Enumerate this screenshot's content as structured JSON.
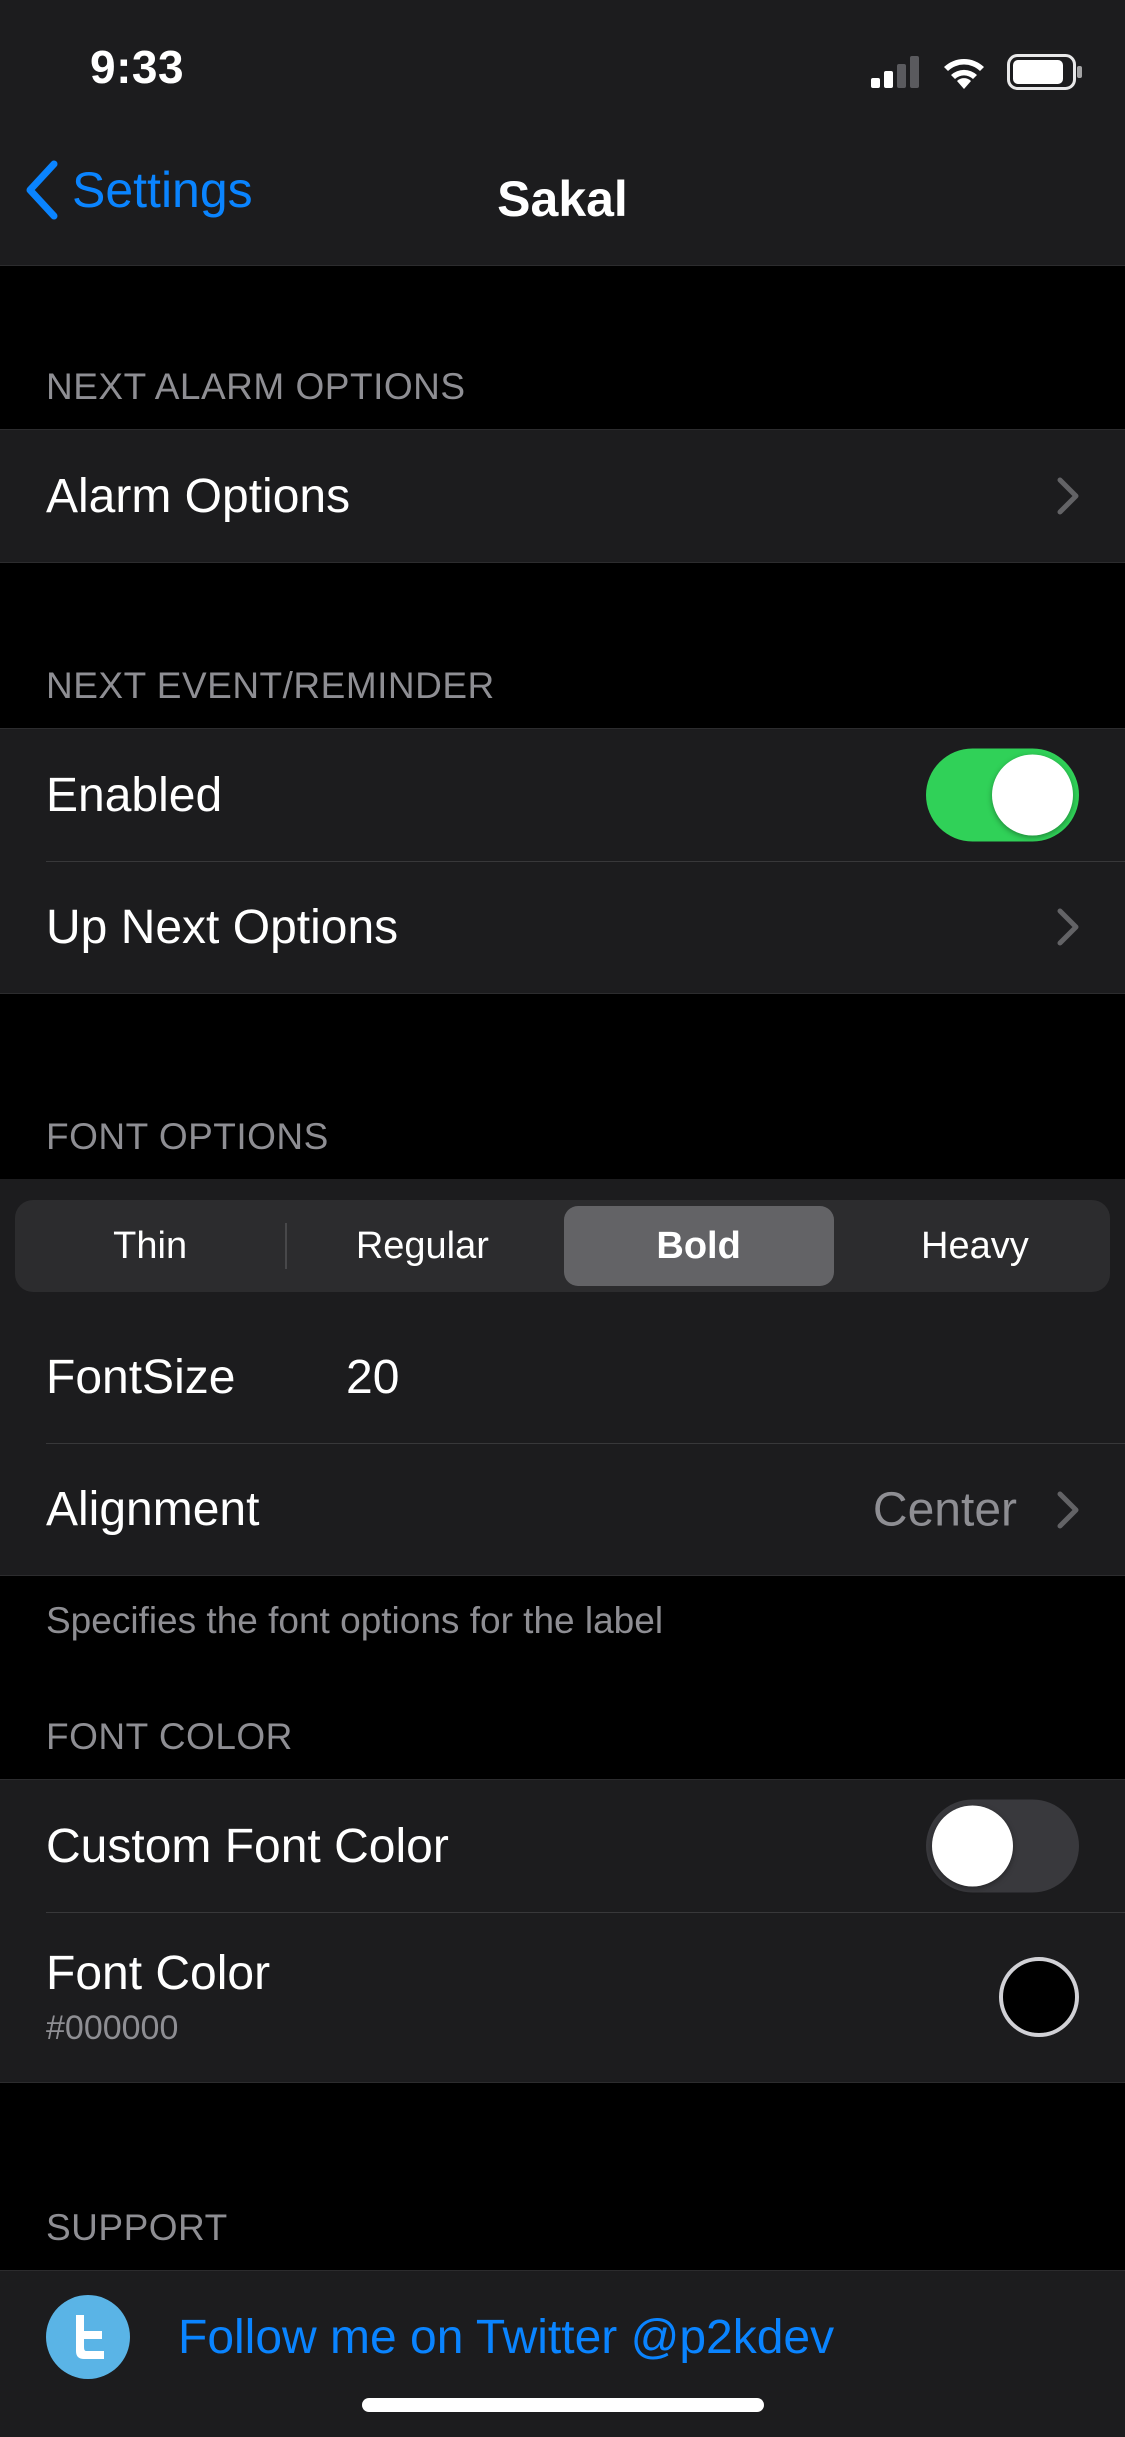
{
  "status_bar": {
    "time": "9:33"
  },
  "nav": {
    "back_label": "Settings",
    "title": "Sakal"
  },
  "sections": {
    "next_alarm": {
      "header": "NEXT ALARM OPTIONS",
      "alarm_options": "Alarm Options"
    },
    "next_event": {
      "header": "NEXT EVENT/REMINDER",
      "enabled_label": "Enabled",
      "enabled_on": true,
      "up_next_options": "Up Next Options"
    },
    "font_options": {
      "header": "FONT OPTIONS",
      "weights": [
        "Thin",
        "Regular",
        "Bold",
        "Heavy"
      ],
      "selected_weight": "Bold",
      "font_size_label": "FontSize",
      "font_size_value": "20",
      "alignment_label": "Alignment",
      "alignment_value": "Center",
      "footer": "Specifies the font options for the label"
    },
    "font_color": {
      "header": "FONT COLOR",
      "custom_font_color_label": "Custom Font Color",
      "custom_font_color_on": false,
      "font_color_label": "Font Color",
      "font_color_value": "#000000"
    },
    "support": {
      "header": "SUPPORT",
      "twitter_label": "Follow me on Twitter @p2kdev"
    }
  },
  "colors": {
    "accent": "#0a84ff",
    "toggle_on": "#30d158",
    "twitter": "#5ab4e6"
  }
}
